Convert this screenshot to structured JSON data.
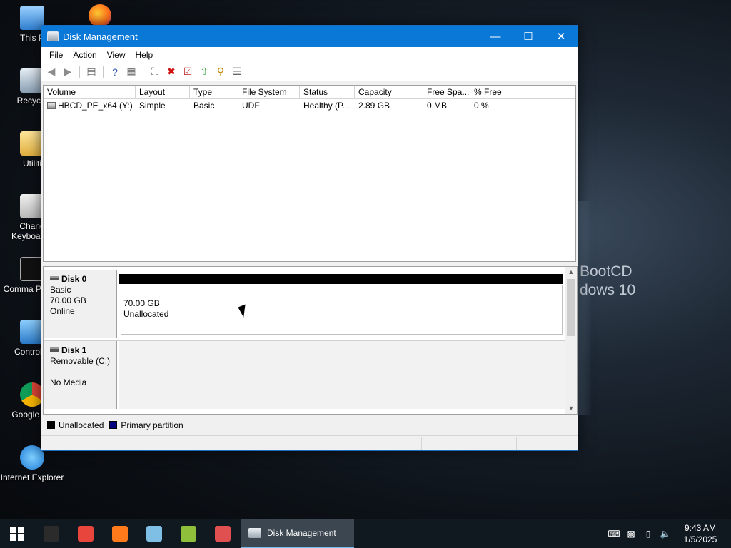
{
  "desktop": {
    "icons": [
      {
        "label": "This P",
        "icon": "this-pc-icon"
      },
      {
        "label": "Recycle",
        "icon": "recycle-bin-icon"
      },
      {
        "label": "Utiliti",
        "icon": "folder-icon"
      },
      {
        "label": "Chang Keyboard I",
        "icon": "keyboard-settings-icon"
      },
      {
        "label": "Comma Promp",
        "icon": "command-prompt-icon"
      },
      {
        "label": "Control P",
        "icon": "control-panel-icon"
      },
      {
        "label": "Google Ch",
        "icon": "chrome-icon"
      },
      {
        "label": "Internet Explorer",
        "icon": "internet-explorer-icon"
      }
    ],
    "wallpaper": {
      "line1": "BootCD",
      "line2": "dows 10"
    }
  },
  "window": {
    "title": "Disk Management",
    "controls": {
      "minimize": "—",
      "maximize": "☐",
      "close": "✕"
    },
    "menu": [
      "File",
      "Action",
      "View",
      "Help"
    ],
    "toolbar": [
      {
        "icon": "back-arrow-icon",
        "glyph": "◀",
        "color": "#8c8c8c"
      },
      {
        "icon": "forward-arrow-icon",
        "glyph": "▶",
        "color": "#8c8c8c"
      },
      {
        "icon": "console-tree-icon",
        "glyph": "▤",
        "color": "#6a6a6a"
      },
      {
        "icon": "help-icon",
        "glyph": "?",
        "color": "#2a52a8"
      },
      {
        "icon": "properties-icon",
        "glyph": "▦",
        "color": "#6a6a6a"
      },
      {
        "icon": "connect-disk-icon",
        "glyph": "⛶",
        "color": "#6a6a6a"
      },
      {
        "icon": "delete-icon",
        "glyph": "✖",
        "color": "#d01010"
      },
      {
        "icon": "check-icon",
        "glyph": "☑",
        "color": "#c02020"
      },
      {
        "icon": "up-folder-icon",
        "glyph": "⇧",
        "color": "#3a9a3a"
      },
      {
        "icon": "search-icon",
        "glyph": "⚲",
        "color": "#c08a00"
      },
      {
        "icon": "settings-list-icon",
        "glyph": "☰",
        "color": "#6a6a6a"
      }
    ],
    "volumes": {
      "columns": [
        "Volume",
        "Layout",
        "Type",
        "File System",
        "Status",
        "Capacity",
        "Free Spa...",
        "% Free"
      ],
      "rows": [
        [
          "HBCD_PE_x64 (Y:)",
          "Simple",
          "Basic",
          "UDF",
          "Healthy (P...",
          "2.89 GB",
          "0 MB",
          "0 %"
        ]
      ]
    },
    "disks": [
      {
        "name": "Disk 0",
        "line1": "Basic",
        "line2": "70.00 GB",
        "line3": "Online",
        "partition_size": "70.00 GB",
        "partition_label": "Unallocated"
      },
      {
        "name": "Disk 1",
        "line1": "Removable (C:)",
        "line2": "",
        "line3": "No Media"
      }
    ],
    "legend": [
      {
        "label": "Unallocated",
        "color": "#000000"
      },
      {
        "label": "Primary partition",
        "color": "#000080"
      }
    ]
  },
  "taskbar": {
    "active_task": "Disk Management",
    "pinned": [
      {
        "icon": "start-icon",
        "color": "#ffffff"
      },
      {
        "icon": "command-prompt-icon",
        "color": "#2b2b2b"
      },
      {
        "icon": "chrome-icon",
        "color": "#e8453c"
      },
      {
        "icon": "firefox-icon",
        "color": "#ff7a1a"
      },
      {
        "icon": "notepad-icon",
        "color": "#7fbfe6"
      },
      {
        "icon": "task-tool-icon",
        "color": "#8fbf3a"
      },
      {
        "icon": "network-tool-icon",
        "color": "#e05050"
      }
    ],
    "tray": [
      {
        "icon": "keyboard-layout-icon",
        "glyph": "⌨"
      },
      {
        "icon": "display-color-icon",
        "glyph": "▩"
      },
      {
        "icon": "usb-drive-icon",
        "glyph": "▯"
      },
      {
        "icon": "volume-muted-icon",
        "glyph": "🔈"
      }
    ],
    "time": "9:43 AM",
    "date": "1/5/2025"
  }
}
